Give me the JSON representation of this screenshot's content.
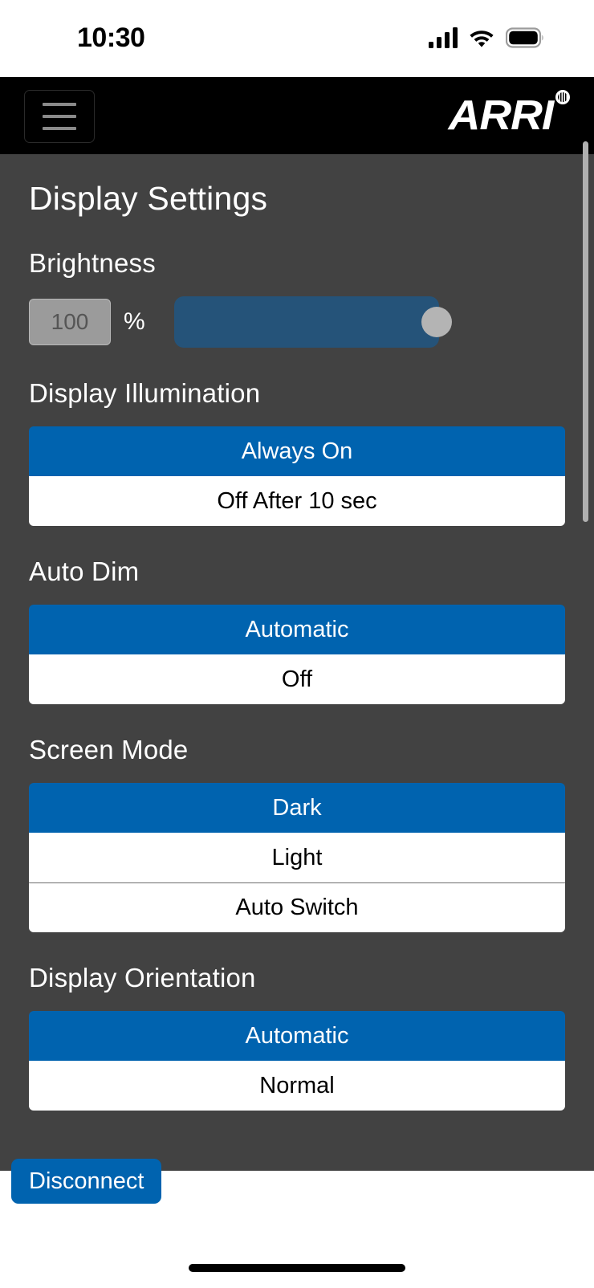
{
  "status_bar": {
    "time": "10:30",
    "signal_icon": "cellular-signal-icon",
    "wifi_icon": "wifi-icon",
    "battery_icon": "battery-full-icon"
  },
  "app_bar": {
    "menu_icon": "hamburger-menu-icon",
    "brand": "ARRI",
    "brand_mark": "registered-trademark-icon"
  },
  "page": {
    "title": "Display Settings"
  },
  "brightness": {
    "label": "Brightness",
    "value": "100",
    "placeholder": "100",
    "unit": "%",
    "slider_percent": 100
  },
  "sections": [
    {
      "label": "Display Illumination",
      "options": [
        {
          "label": "Always On",
          "selected": true
        },
        {
          "label": "Off After 10 sec",
          "selected": false
        }
      ]
    },
    {
      "label": "Auto Dim",
      "options": [
        {
          "label": "Automatic",
          "selected": true
        },
        {
          "label": "Off",
          "selected": false
        }
      ]
    },
    {
      "label": "Screen Mode",
      "options": [
        {
          "label": "Dark",
          "selected": true
        },
        {
          "label": "Light",
          "selected": false
        },
        {
          "label": "Auto Switch",
          "selected": false
        }
      ]
    },
    {
      "label": "Display Orientation",
      "options": [
        {
          "label": "Automatic",
          "selected": true
        },
        {
          "label": "Normal",
          "selected": false
        }
      ]
    }
  ],
  "footer": {
    "disconnect_label": "Disconnect"
  },
  "colors": {
    "accent_blue": "#0063AF",
    "slider_blue": "#255379",
    "background_gray": "#424242",
    "appbar_black": "#000000",
    "option_white": "#ffffff"
  }
}
